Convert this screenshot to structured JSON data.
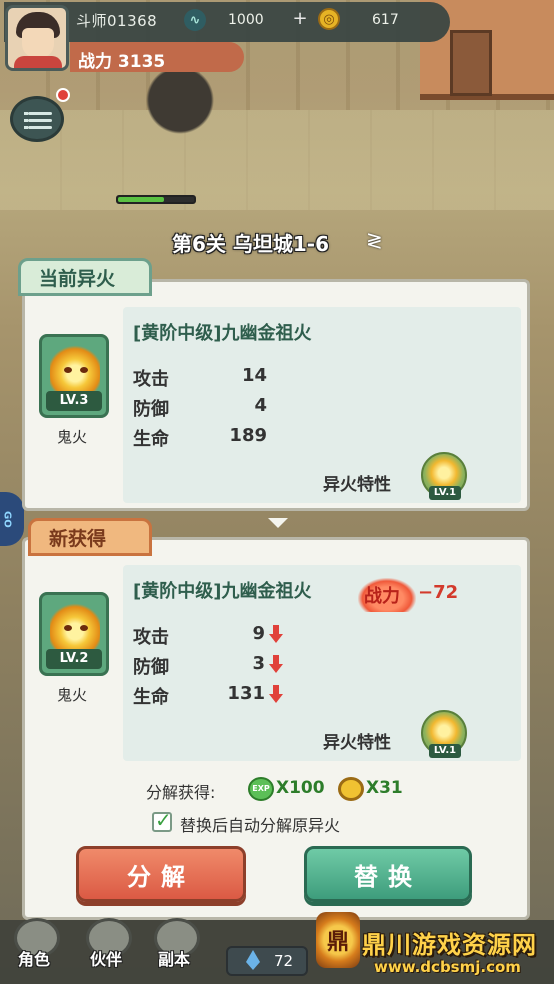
{
  "hud": {
    "player_name": "斗师01368",
    "resource1_value": "1000",
    "resource1_icon": "spirit-icon",
    "add_icon": "+",
    "resource2_value": "617",
    "resource2_icon": "gold-coin-icon",
    "power_label": "战力 3135"
  },
  "stage": {
    "label": "第6关 乌坦城1-6",
    "cycle_icon": "≷",
    "enemy_hp_fraction": 0.6
  },
  "current_fire": {
    "tab_label": "当前异火",
    "level": "LV.3",
    "name": "鬼火",
    "title": "[黄阶中级]九幽金祖火",
    "stats": [
      {
        "label": "攻击",
        "value": "14"
      },
      {
        "label": "防御",
        "value": "4"
      },
      {
        "label": "生命",
        "value": "189"
      }
    ],
    "trait_label": "异火特性",
    "trait_level": "LV.1"
  },
  "new_fire": {
    "tab_label": "新获得",
    "level": "LV.2",
    "name": "鬼火",
    "title": "[黄阶中级]九幽金祖火",
    "power_diff_label": "战力",
    "power_diff_value": "−72",
    "stats": [
      {
        "label": "攻击",
        "value": "9"
      },
      {
        "label": "防御",
        "value": "3"
      },
      {
        "label": "生命",
        "value": "131"
      }
    ],
    "trait_label": "异火特性",
    "trait_level": "LV.1",
    "decompose_label": "分解获得:",
    "exp_icon_text": "EXP",
    "exp_value": "X100",
    "coin_value": "X31",
    "auto_decompose_checked": true,
    "auto_decompose_label": "替换后自动分解原异火",
    "decompose_button": "分解",
    "replace_button": "替换"
  },
  "bottom_nav": {
    "items": [
      "角色",
      "伙伴",
      "副本"
    ],
    "gem_value": "72"
  },
  "watermark": {
    "logo_char": "鼎",
    "title": "鼎川游戏资源网",
    "url": "www.dcbsmj.com"
  },
  "colors": {
    "accent_green": "#3e9d7c",
    "accent_red": "#db5a44",
    "down_arrow": "#e0413a"
  }
}
